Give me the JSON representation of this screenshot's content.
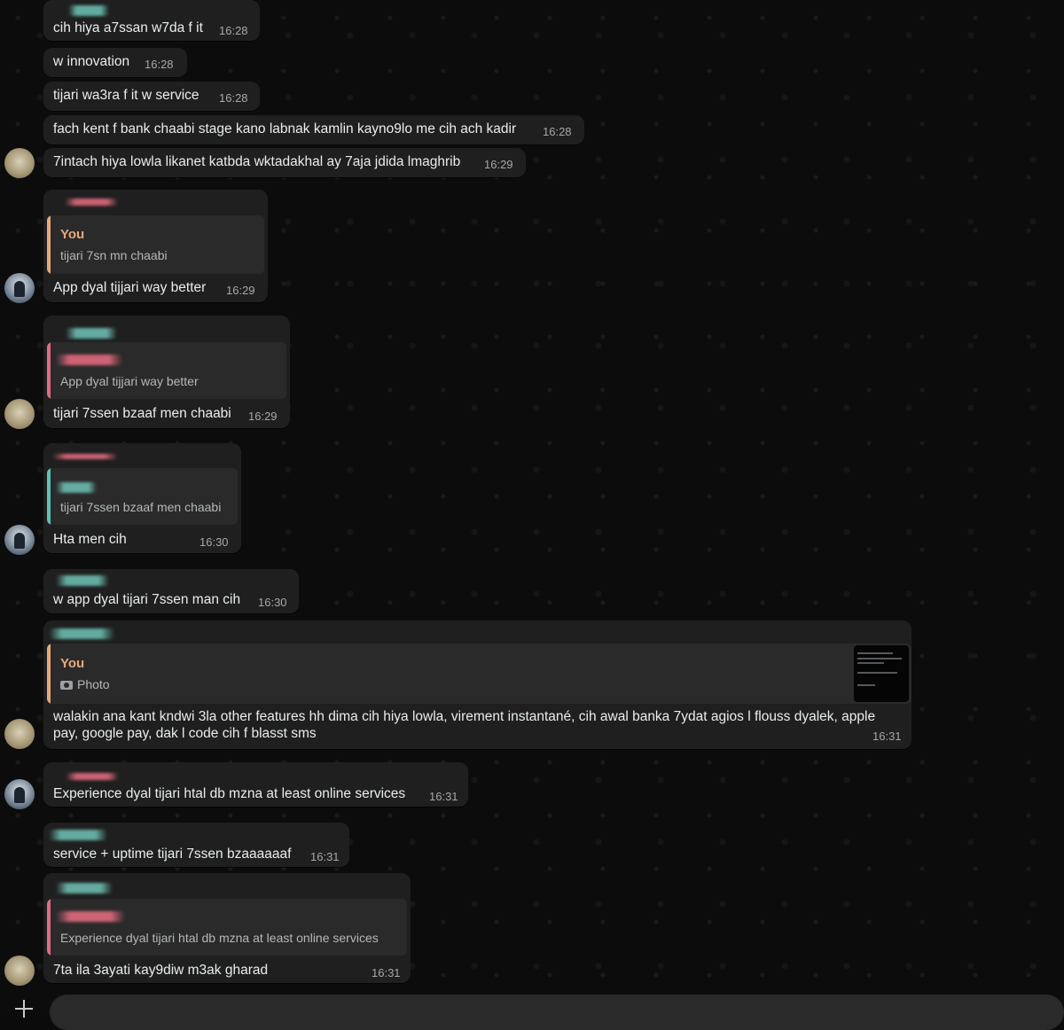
{
  "messages": [
    {
      "text": "cih hiya a7ssan w7da f it",
      "time": "16:28"
    },
    {
      "text": "w innovation",
      "time": "16:28"
    },
    {
      "text": "tijari wa3ra f it w service",
      "time": "16:28"
    },
    {
      "text": "fach kent f bank chaabi stage kano labnak kamlin kayno9lo me cih ach kadir",
      "time": "16:28"
    },
    {
      "text": "7intach hiya lowla likanet katbda wktadakhal ay 7aja jdida lmaghrib",
      "time": "16:29"
    },
    {
      "text": "App dyal tijjari way better",
      "time": "16:29",
      "quote_name": "You",
      "quote_text": "tijari 7sn mn chaabi"
    },
    {
      "text": "tijari 7ssen bzaaf men chaabi",
      "time": "16:29",
      "quote_text": "App dyal tijjari way better"
    },
    {
      "text": "Hta men cih",
      "time": "16:30",
      "quote_text": "tijari 7ssen bzaaf men chaabi"
    },
    {
      "text": "w app dyal tijari 7ssen man cih",
      "time": "16:30"
    },
    {
      "text_line1": "walakin ana kant kndwi 3la other features hh dima cih hiya lowla, virement instantané, cih awal banka 7ydat agios l flouss dyalek, apple",
      "text_line2": "pay, google pay, dak l code cih f blasst sms",
      "time": "16:31",
      "quote_name": "You",
      "quote_text": "Photo"
    },
    {
      "text": "Experience dyal tijari htal db mzna at least online services",
      "time": "16:31"
    },
    {
      "text": "service + uptime tijari 7ssen bzaaaaaaf",
      "time": "16:31"
    },
    {
      "text": "7ta ila 3ayati kay9diw m3ak gharad",
      "time": "16:31",
      "quote_text": "Experience dyal tijari htal db mzna at least online services"
    }
  ],
  "colors": {
    "quote_you": "#e8a87c",
    "quote_other": "#e06c85",
    "quote_teal": "#5fc4b1",
    "bubble": "#1f1f1f",
    "background": "#0b0b0b"
  },
  "icons": [
    "camera-icon",
    "plus-icon"
  ]
}
